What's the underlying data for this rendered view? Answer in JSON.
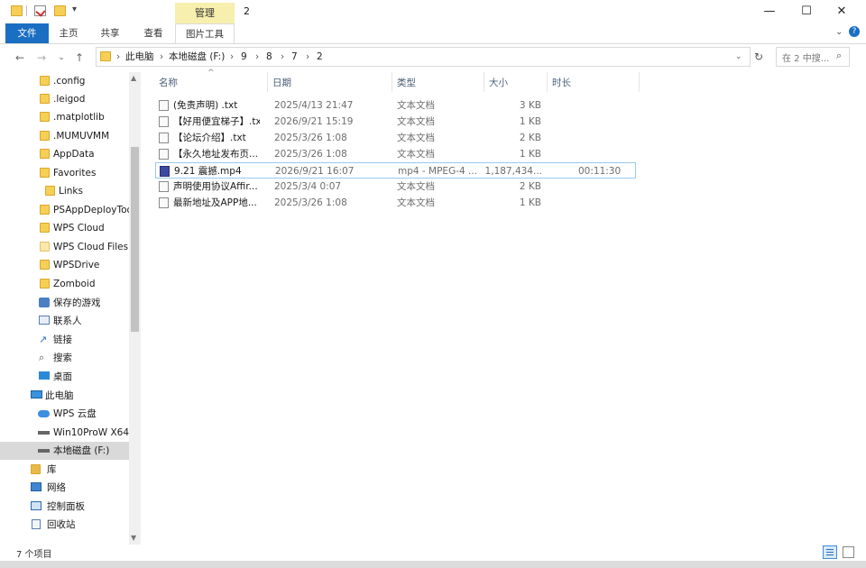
{
  "window": {
    "title": "2",
    "manage_tab": "管理",
    "minimize": "—",
    "maximize": "☐",
    "close": "✕"
  },
  "ribbon": {
    "tabs": [
      "文件",
      "主页",
      "共享",
      "查看",
      "图片工具"
    ]
  },
  "address": {
    "crumbs": [
      "此电脑",
      "本地磁盘 (F:)",
      "9",
      "8",
      "7",
      "2"
    ],
    "search_placeholder": "在 2 中搜..."
  },
  "sidebar": {
    "items": [
      {
        "label": ".config",
        "icon": "folder-icon"
      },
      {
        "label": ".leigod",
        "icon": "folder-icon"
      },
      {
        "label": ".matplotlib",
        "icon": "folder-icon"
      },
      {
        "label": ".MUMUVMM",
        "icon": "folder-icon"
      },
      {
        "label": "AppData",
        "icon": "folder-icon"
      },
      {
        "label": "Favorites",
        "icon": "folder-icon"
      },
      {
        "label": "Links",
        "icon": "folder-icon"
      },
      {
        "label": "PSAppDeployToo",
        "icon": "folder-icon"
      },
      {
        "label": "WPS Cloud",
        "icon": "folder-icon"
      },
      {
        "label": "WPS Cloud Files",
        "icon": "folder-icon"
      },
      {
        "label": "WPSDrive",
        "icon": "folder-icon"
      },
      {
        "label": "Zomboid",
        "icon": "folder-icon"
      },
      {
        "label": "保存的游戏",
        "icon": "games-icon"
      },
      {
        "label": "联系人",
        "icon": "contacts-icon"
      },
      {
        "label": "链接",
        "icon": "link-icon"
      },
      {
        "label": "搜索",
        "icon": "search-icon"
      },
      {
        "label": "桌面",
        "icon": "desktop-icon"
      },
      {
        "label": "此电脑",
        "icon": "computer-icon"
      },
      {
        "label": "WPS 云盘",
        "icon": "cloud-icon"
      },
      {
        "label": "Win10ProW X64",
        "icon": "drive-icon"
      },
      {
        "label": "本地磁盘 (F:)",
        "icon": "drive-icon"
      },
      {
        "label": "库",
        "icon": "library-icon"
      },
      {
        "label": "网络",
        "icon": "network-icon"
      },
      {
        "label": "控制面板",
        "icon": "control-panel-icon"
      },
      {
        "label": "回收站",
        "icon": "recycle-bin-icon"
      }
    ]
  },
  "columns": {
    "name": "名称",
    "date": "日期",
    "type": "类型",
    "size": "大小",
    "length": "时长"
  },
  "files": [
    {
      "name": "(免责声明) .txt",
      "date": "2025/4/13 21:47",
      "type": "文本文档",
      "size": "3 KB",
      "length": "",
      "icon": "text-file-icon"
    },
    {
      "name": "【好用便宜梯子】.txt",
      "date": "2026/9/21 15:19",
      "type": "文本文档",
      "size": "1 KB",
      "length": "",
      "icon": "text-file-icon"
    },
    {
      "name": "【论坛介绍】.txt",
      "date": "2025/3/26 1:08",
      "type": "文本文档",
      "size": "2 KB",
      "length": "",
      "icon": "text-file-icon"
    },
    {
      "name": "【永久地址发布页...",
      "date": "2025/3/26 1:08",
      "type": "文本文档",
      "size": "1 KB",
      "length": "",
      "icon": "text-file-icon"
    },
    {
      "name": "9.21 震撼.mp4",
      "date": "2026/9/21 16:07",
      "type": "mp4 - MPEG-4 ...",
      "size": "1,187,434...",
      "length": "00:11:30",
      "icon": "video-file-icon"
    },
    {
      "name": "声明使用协议Affir...",
      "date": "2025/3/4 0:07",
      "type": "文本文档",
      "size": "2 KB",
      "length": "",
      "icon": "text-file-icon"
    },
    {
      "name": "最新地址及APP地...",
      "date": "2025/3/26 1:08",
      "type": "文本文档",
      "size": "1 KB",
      "length": "",
      "icon": "text-file-icon"
    }
  ],
  "status": {
    "count": "7 个项目"
  }
}
